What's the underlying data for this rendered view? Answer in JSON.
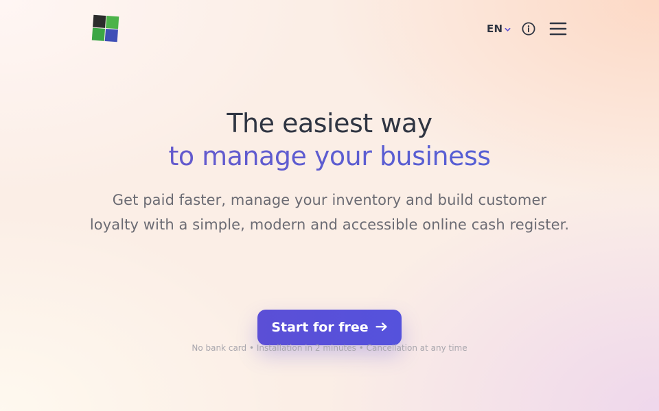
{
  "header": {
    "logo_icon": "four-squares-logo",
    "language": {
      "label": "EN",
      "icon": "chevron-down-icon"
    },
    "info_icon": "info-circle-icon",
    "menu_icon": "hamburger-menu-icon"
  },
  "hero": {
    "title_line1": "The easiest way",
    "title_line2": "to manage your business",
    "subtitle": "Get paid faster, manage your inventory and build customer loyalty with a simple, modern and accessible online cash register.",
    "cta_label": "Start for free",
    "cta_icon": "arrow-right-icon",
    "note": "No bank card • Installation in 2 minutes • Cancellation at any time"
  },
  "colors": {
    "accent": "#5b4fd6",
    "gradient_start": "#6b57c9",
    "gradient_end": "#4f62d8",
    "heading": "#2f3542",
    "body_text": "#6b6b73",
    "muted": "#a8a6ad"
  }
}
